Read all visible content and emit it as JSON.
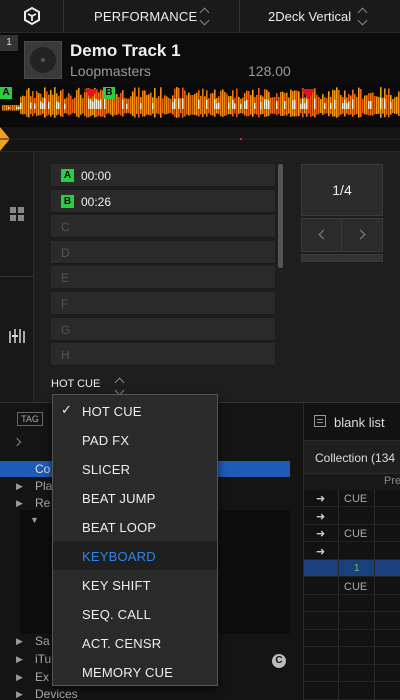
{
  "topbar": {
    "mode_label": "PERFORMANCE",
    "layout_label": "2Deck Vertical"
  },
  "deck": {
    "number": "1",
    "title": "Demo Track 1",
    "artist": "Loopmasters",
    "bpm": "128.00",
    "markers": [
      "A",
      "B"
    ]
  },
  "hotcues": {
    "rows": [
      {
        "letter": "A",
        "time": "00:00",
        "set": true
      },
      {
        "letter": "B",
        "time": "00:26",
        "set": true
      },
      {
        "letter": "C",
        "time": "",
        "set": false
      },
      {
        "letter": "D",
        "time": "",
        "set": false
      },
      {
        "letter": "E",
        "time": "",
        "set": false
      },
      {
        "letter": "F",
        "time": "",
        "set": false
      },
      {
        "letter": "G",
        "time": "",
        "set": false
      },
      {
        "letter": "H",
        "time": "",
        "set": false
      }
    ],
    "page": "1/4",
    "mode_label": "HOT CUE",
    "badge_color": "#2ecc40"
  },
  "browser": {
    "tag_label": "TAG",
    "tree": [
      {
        "label": "Co",
        "selected": true,
        "tri": ""
      },
      {
        "label": "Pla",
        "selected": false,
        "tri": "▶"
      },
      {
        "label": "Re",
        "selected": false,
        "tri": "▶"
      },
      {
        "label": "",
        "selected": false,
        "tri": "▼"
      },
      {
        "label": "Sa",
        "selected": false,
        "tri": "▶"
      },
      {
        "label": "iTu",
        "selected": false,
        "tri": "▶"
      },
      {
        "label": "Ex",
        "selected": false,
        "tri": "▶"
      },
      {
        "label": "Devices",
        "selected": false,
        "tri": "▶"
      }
    ],
    "blank_list": "blank list",
    "collection": "Collection (134",
    "col_header": "Pre",
    "rows": [
      {
        "arrow": "➜",
        "cue": "CUE",
        "num": ""
      },
      {
        "arrow": "➜",
        "cue": "",
        "num": ""
      },
      {
        "arrow": "➜",
        "cue": "CUE",
        "num": ""
      },
      {
        "arrow": "➜",
        "cue": "",
        "num": ""
      },
      {
        "arrow": "",
        "cue": "",
        "num": "1"
      },
      {
        "arrow": "",
        "cue": "CUE",
        "num": ""
      }
    ],
    "c_icon": "C",
    "selection_color": "#1d5bb5"
  },
  "dropdown": {
    "items": [
      {
        "label": "HOT CUE",
        "checked": true,
        "active": false
      },
      {
        "label": "PAD FX",
        "checked": false,
        "active": false
      },
      {
        "label": "SLICER",
        "checked": false,
        "active": false
      },
      {
        "label": "BEAT JUMP",
        "checked": false,
        "active": false
      },
      {
        "label": "BEAT LOOP",
        "checked": false,
        "active": false
      },
      {
        "label": "KEYBOARD",
        "checked": false,
        "active": true
      },
      {
        "label": "KEY SHIFT",
        "checked": false,
        "active": false
      },
      {
        "label": "SEQ. CALL",
        "checked": false,
        "active": false
      },
      {
        "label": "ACT. CENSR",
        "checked": false,
        "active": false
      },
      {
        "label": "MEMORY CUE",
        "checked": false,
        "active": false
      }
    ],
    "check_glyph": "✓",
    "active_color": "#2f86e8"
  }
}
